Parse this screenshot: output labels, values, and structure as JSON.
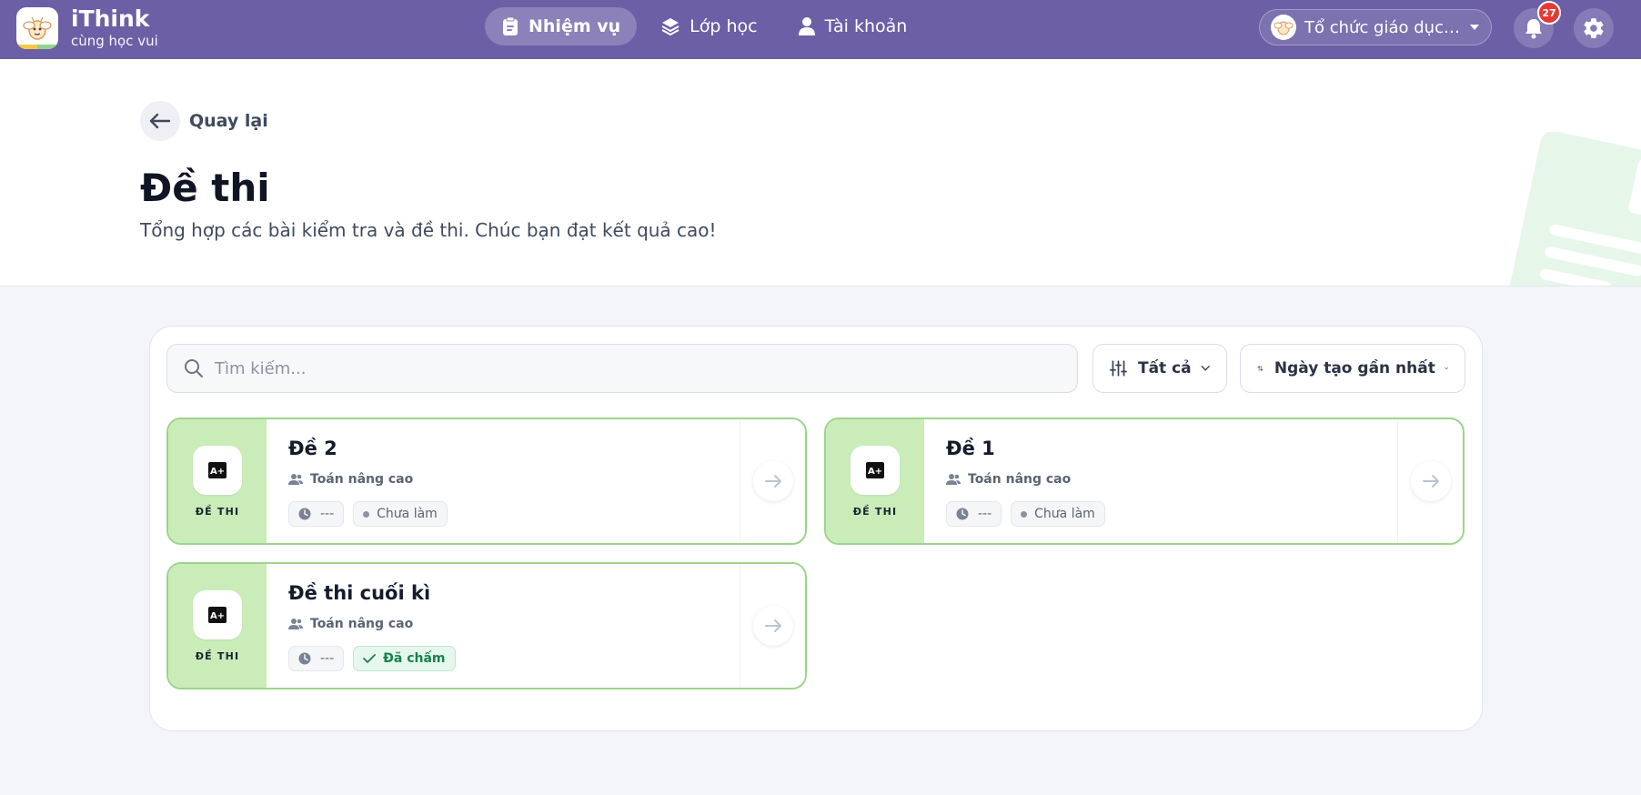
{
  "app": {
    "name": "iThink",
    "tagline": "cùng học vui"
  },
  "nav": {
    "items": [
      {
        "label": "Nhiệm vụ",
        "icon": "clipboard-icon",
        "active": true
      },
      {
        "label": "Lớp học",
        "icon": "layers-icon",
        "active": false
      },
      {
        "label": "Tài khoản",
        "icon": "user-icon",
        "active": false
      }
    ]
  },
  "org": {
    "name": "Tổ chức giáo dục ..."
  },
  "notifications": {
    "count": "27"
  },
  "header": {
    "back_label": "Quay lại",
    "title": "Đề thi",
    "subtitle": "Tổng hợp các bài kiểm tra và đề thi. Chúc bạn đạt kết quả cao!"
  },
  "search": {
    "placeholder": "Tìm kiếm..."
  },
  "filters": {
    "type_label": "Tất cả",
    "sort_label": "Ngày tạo gần nhất"
  },
  "exams": [
    {
      "type": "ĐỀ THI",
      "title": "Đề 2",
      "class": "Toán nâng cao",
      "time": "---",
      "status": "Chưa làm",
      "done": false
    },
    {
      "type": "ĐỀ THI",
      "title": "Đề 1",
      "class": "Toán nâng cao",
      "time": "---",
      "status": "Chưa làm",
      "done": false
    },
    {
      "type": "ĐỀ THI",
      "title": "Đề thi cuối kì",
      "class": "Toán nâng cao",
      "time": "---",
      "status": "Đã chấm",
      "done": true
    }
  ],
  "colors": {
    "primary": "#6c5fa6",
    "card_border": "#9cd48c",
    "card_side": "#c9ecb8",
    "status_done": "#17824a"
  }
}
